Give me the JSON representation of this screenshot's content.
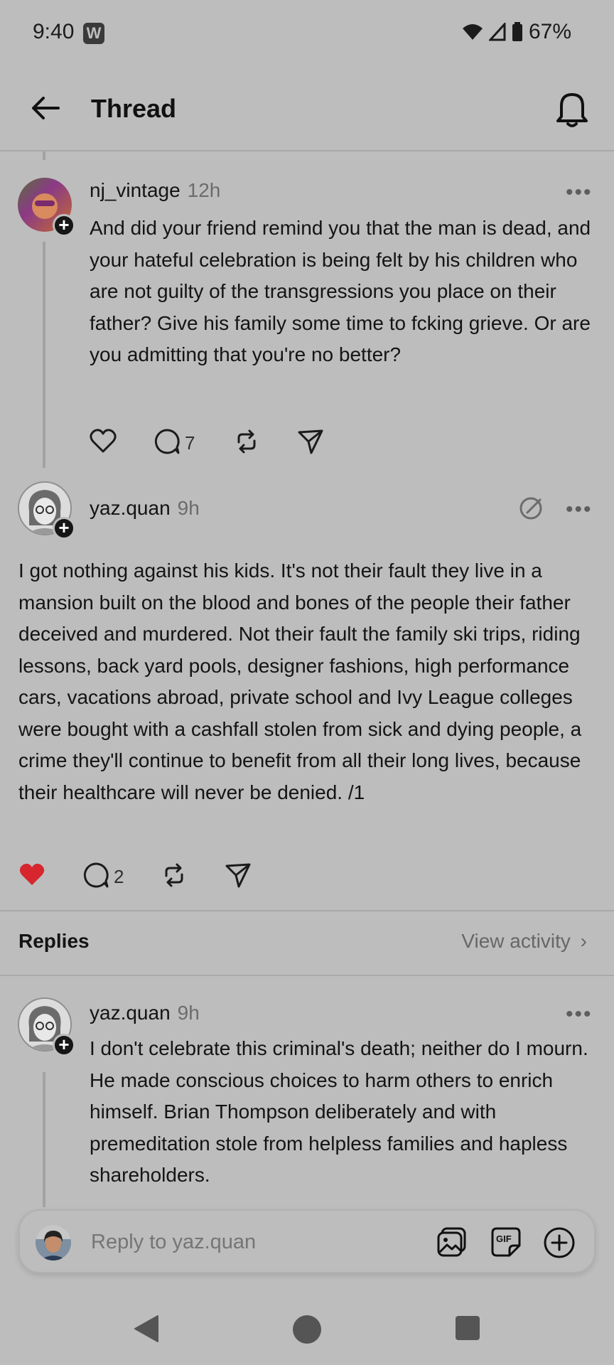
{
  "status_bar": {
    "time": "9:40",
    "app_badge": "W",
    "battery": "67%"
  },
  "header": {
    "title": "Thread"
  },
  "parent_post": {
    "username": "nj_vintage",
    "time": "12h",
    "text": "And did your friend remind you that the man is dead, and your hateful celebration is being felt by his children who are not guilty of the transgressions you place on their father? Give his family some time to fcking grieve. Or are you admitting that you're no better?",
    "reply_count": "7"
  },
  "main_post": {
    "username": "yaz.quan",
    "time": "9h",
    "text": "I got nothing against his kids. It's not their fault they live in a mansion built on the blood and bones of the people their father deceived and murdered. Not their fault the family ski trips, riding lessons, back yard pools, designer fashions, high performance cars, vacations abroad, private school and Ivy League colleges were bought with a cashfall stolen from sick and dying people, a crime they'll continue to benefit from all their long lives, because their healthcare will never be denied. /1",
    "reply_count": "2",
    "liked": true,
    "like_color": "#d7262e"
  },
  "replies_section": {
    "label": "Replies",
    "view_activity": "View activity"
  },
  "reply_post": {
    "username": "yaz.quan",
    "time": "9h",
    "text": "I don't celebrate this criminal's death; neither do I mourn. He made conscious choices to harm others to enrich himself. Brian Thompson deliberately and with premeditation stole from helpless families and hapless shareholders."
  },
  "composer": {
    "placeholder": "Reply to yaz.quan",
    "gif_label": "GIF"
  },
  "icons": {
    "back": "arrow-left-icon",
    "bell": "bell-icon",
    "more": "more-dots-icon",
    "like": "heart-icon",
    "comment": "comment-icon",
    "repost": "repost-icon",
    "share": "send-icon",
    "edit": "edit-circle-icon",
    "image": "image-icon",
    "gif": "gif-icon",
    "add": "plus-circle-icon"
  }
}
